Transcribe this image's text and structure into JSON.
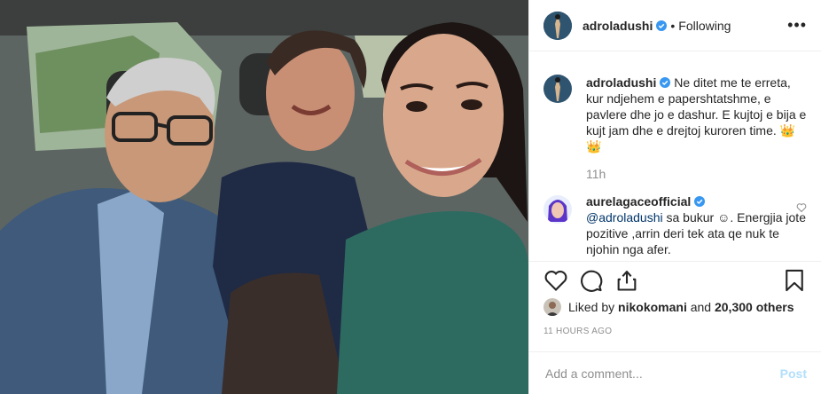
{
  "post": {
    "image_alt": "Selfie of three people sitting in a car",
    "header": {
      "username": "adroladushi",
      "separator": "•",
      "follow_status": "Following",
      "more_label": "•••"
    },
    "caption": {
      "username": "adroladushi",
      "text": "Ne ditet me te erreta, kur ndjehem e papershtatshme, e pavlere dhe jo e dashur. E kujtoj e bija e kujt jam dhe e drejtoj kuroren time. 👑👑",
      "time": "11h"
    },
    "comments": [
      {
        "username": "aurelagaceofficial",
        "mention": "@adroladushi",
        "text": "sa bukur ☺. Energjia jote pozitive ,arrin deri tek ata qe nuk te njohin nga afer."
      }
    ],
    "likes": {
      "prefix": "Liked by",
      "user": "nikokomani",
      "joiner": "and",
      "others": "20,300 others"
    },
    "timestamp": "11 HOURS AGO",
    "add_comment": {
      "placeholder": "Add a comment...",
      "post_label": "Post"
    },
    "icons": {
      "like": "heart-icon",
      "comment": "comment-icon",
      "share": "share-icon",
      "save": "bookmark-icon",
      "verified": "verified-badge-icon"
    },
    "colors": {
      "verified": "#3897f0",
      "post_button": "#b2dffc",
      "muted": "#8e8e8e"
    }
  }
}
